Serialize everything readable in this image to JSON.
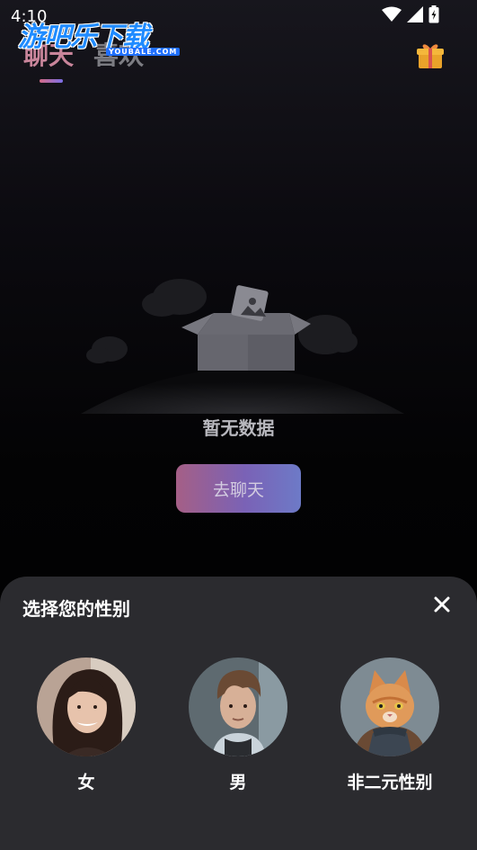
{
  "status": {
    "time": "4:10"
  },
  "watermark": {
    "text": "游吧乐下载",
    "sub": "YOUBALE.COM"
  },
  "tabs": [
    {
      "label": "聊天",
      "active": true
    },
    {
      "label": "喜欢",
      "active": false
    }
  ],
  "empty": {
    "message": "暂无数据",
    "button": "去聊天"
  },
  "sheet": {
    "title": "选择您的性别",
    "options": [
      {
        "label": "女",
        "icon": "woman-avatar"
      },
      {
        "label": "男",
        "icon": "man-avatar"
      },
      {
        "label": "非二元性别",
        "icon": "cat-avatar"
      }
    ]
  },
  "colors": {
    "accent_start": "#a55f86",
    "accent_end": "#6d7ac7",
    "sheet_bg": "#2b2b2f"
  }
}
